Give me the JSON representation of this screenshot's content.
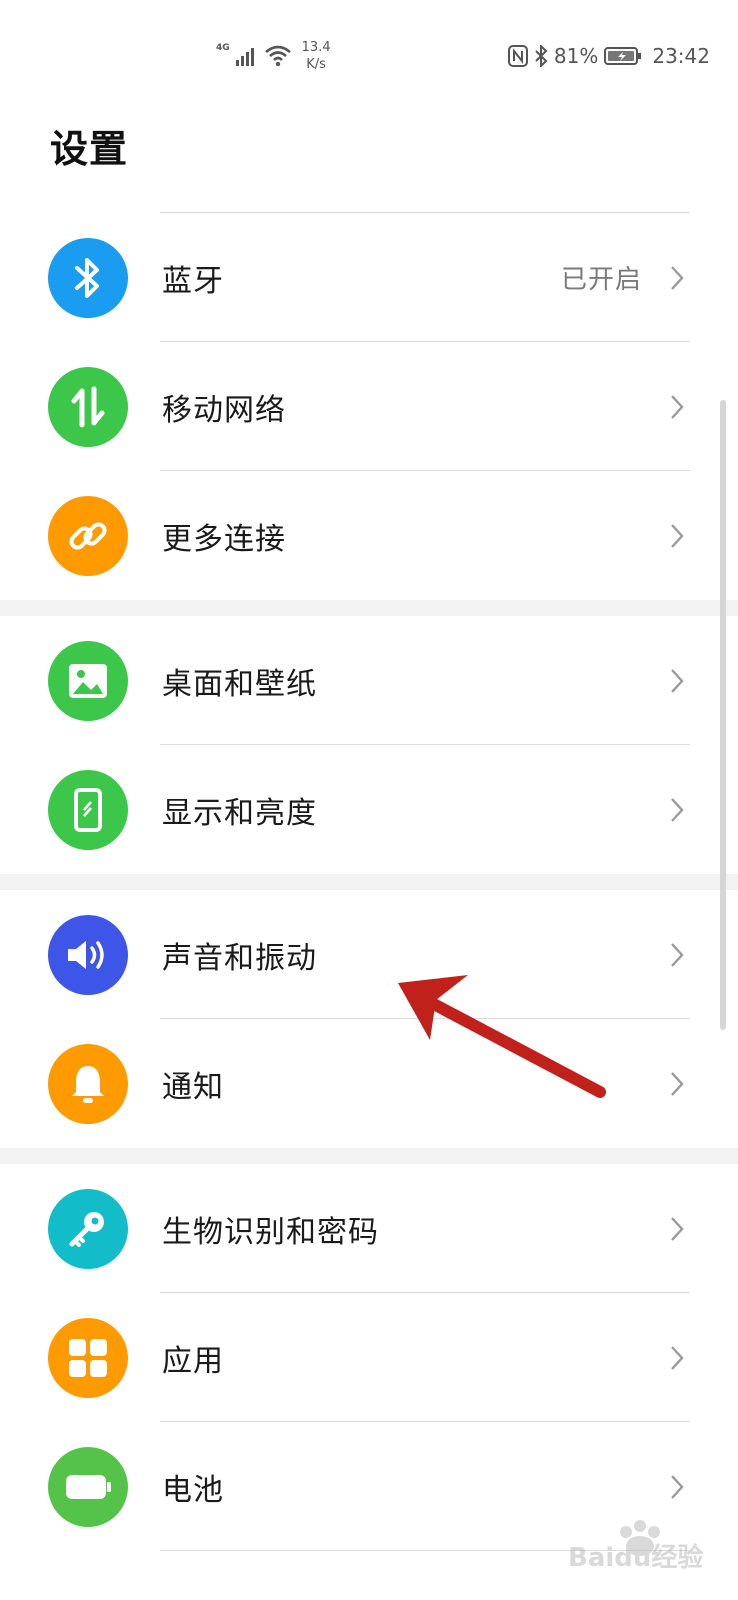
{
  "status_bar": {
    "network_type": "4G",
    "net_speed_value": "13.4",
    "net_speed_unit": "K/s",
    "battery": "81%",
    "time": "23:42"
  },
  "page": {
    "title": "设置"
  },
  "groups": [
    {
      "items": [
        {
          "label": "蓝牙",
          "value": "已开启",
          "icon": "bluetooth-icon",
          "color": "#1a9cf0"
        },
        {
          "label": "移动网络",
          "icon": "mobile-data-icon",
          "color": "#3cc64a"
        },
        {
          "label": "更多连接",
          "icon": "link-icon",
          "color": "#ff9a00"
        }
      ]
    },
    {
      "items": [
        {
          "label": "桌面和壁纸",
          "icon": "wallpaper-icon",
          "color": "#3cc64a"
        },
        {
          "label": "显示和亮度",
          "icon": "display-icon",
          "color": "#3cc64a"
        }
      ]
    },
    {
      "items": [
        {
          "label": "声音和振动",
          "icon": "sound-icon",
          "color": "#3d56e8"
        },
        {
          "label": "通知",
          "icon": "bell-icon",
          "color": "#ff9a00"
        }
      ]
    },
    {
      "items": [
        {
          "label": "生物识别和密码",
          "icon": "key-icon",
          "color": "#12bcc9"
        },
        {
          "label": "应用",
          "icon": "apps-icon",
          "color": "#ff9a00"
        },
        {
          "label": "电池",
          "icon": "battery-icon",
          "color": "#55c24a"
        }
      ]
    }
  ],
  "colors": {
    "annotation_arrow": "#c0221b",
    "divider": "#dcdcdc",
    "group_gap": "#f3f3f3"
  },
  "watermark": "Baidu经验"
}
